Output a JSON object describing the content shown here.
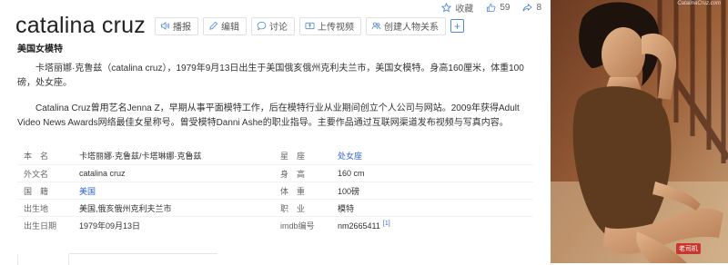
{
  "stats": {
    "collect_label": "收藏",
    "like_count": "59",
    "share_count": "8"
  },
  "entry": {
    "title": "catalina cruz",
    "subtitle": "美国女模特"
  },
  "toolbar": {
    "play": "播报",
    "edit": "编辑",
    "discuss": "讨论",
    "upload_video": "上传视频",
    "create_relation": "创建人物关系",
    "add": "+"
  },
  "paragraphs": {
    "p1": "卡塔丽娜·克鲁兹（catalina cruz），1979年9月13日出生于美国俄亥俄州克利夫兰市，美国女模特。身高160厘米，体重100磅，处女座。",
    "p2": "Catalina Cruz曾用艺名Jenna Z，早期从事平面模特工作，后在模特行业从业期间创立个人公司与网站。2009年获得Adult Video News Awards网络最佳女星称号。曾受模特Danni Ashe的职业指导。主要作品通过互联网渠道发布视频与写真内容。"
  },
  "infobox": {
    "rows": [
      {
        "l1": "本　名",
        "v1": "卡塔丽娜·克鲁兹/卡塔琳娜·克鲁兹",
        "l2": "星　座",
        "v2": "处女座"
      },
      {
        "l1": "外文名",
        "v1": "catalina cruz",
        "l2": "身　高",
        "v2": "160 cm"
      },
      {
        "l1": "国　籍",
        "v1": "美国",
        "l2": "体　重",
        "v2": "100磅"
      },
      {
        "l1": "出生地",
        "v1": "美国,俄亥俄州克利夫兰市",
        "l2": "职　业",
        "v2": "模特"
      },
      {
        "l1": "出生日期",
        "v1": "1979年09月13日",
        "l2": "imdb编号",
        "v2": "nm2665411",
        "ref": "[1]"
      }
    ]
  },
  "photo": {
    "watermark": "CatalinaCruz.com",
    "stamp": "老司机"
  },
  "colors": {
    "link": "#3366cc",
    "accent": "#4f8ad4"
  }
}
